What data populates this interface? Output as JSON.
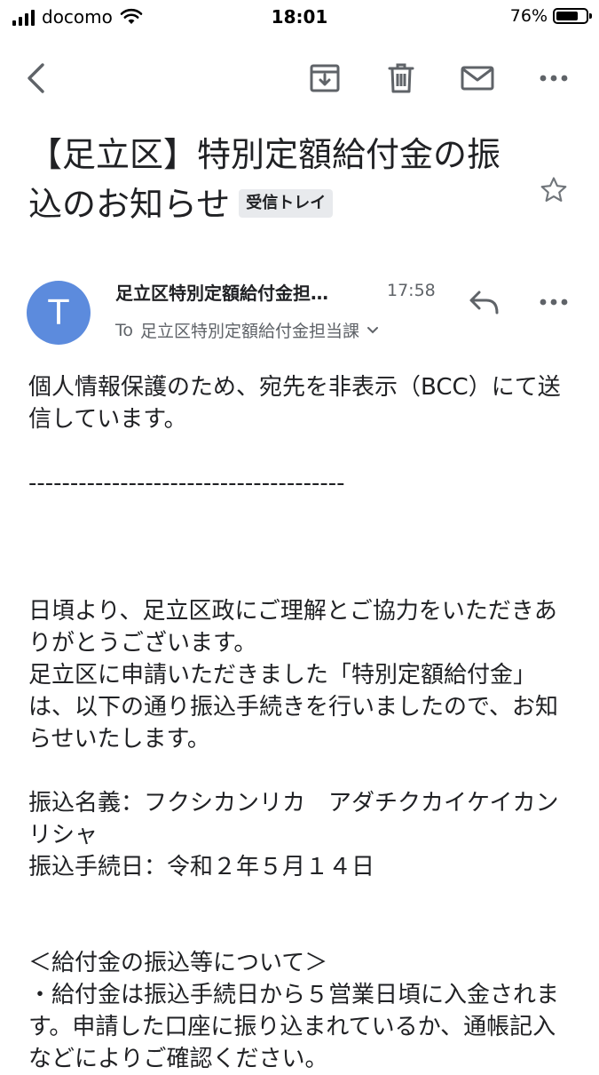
{
  "status_bar": {
    "carrier": "docomo",
    "time": "18:01",
    "battery_percent": "76%",
    "battery_level": 0.76
  },
  "toolbar": {
    "icons": [
      "back-arrow-icon",
      "archive-icon",
      "delete-icon",
      "mark-unread-icon",
      "more-icon"
    ]
  },
  "email": {
    "subject": "【足立区】特別定額給付金の振込のお知らせ",
    "label": "受信トレイ",
    "sender": {
      "avatar_letter": "T",
      "avatar_color": "#5c8bdd",
      "name": "足立区特別定額給付金担…",
      "time": "17:58",
      "to_prefix": "To",
      "to_name": "足立区特別定額給付金担当課"
    },
    "body": {
      "p1": "個人情報保護のため、宛先を非表示（BCC）にて送信しています。",
      "separator": "--------------------------------------",
      "p2": "日頃より、足立区政にご理解とご協力をいただきありがとうございます。\n足立区に申請いただきました「特別定額給付金」は、以下の通り振込手続きを行いましたので、お知らせいたします。",
      "p3": "振込名義：フクシカンリカ　アダチクカイケイカンリシャ\n振込手続日：令和２年５月１４日",
      "p4": "＜給付金の振込等について＞\n・給付金は振込手続日から５営業日頃に入金されます。申請した口座に振り込まれているか、通帳記入などによりご確認ください。"
    }
  }
}
